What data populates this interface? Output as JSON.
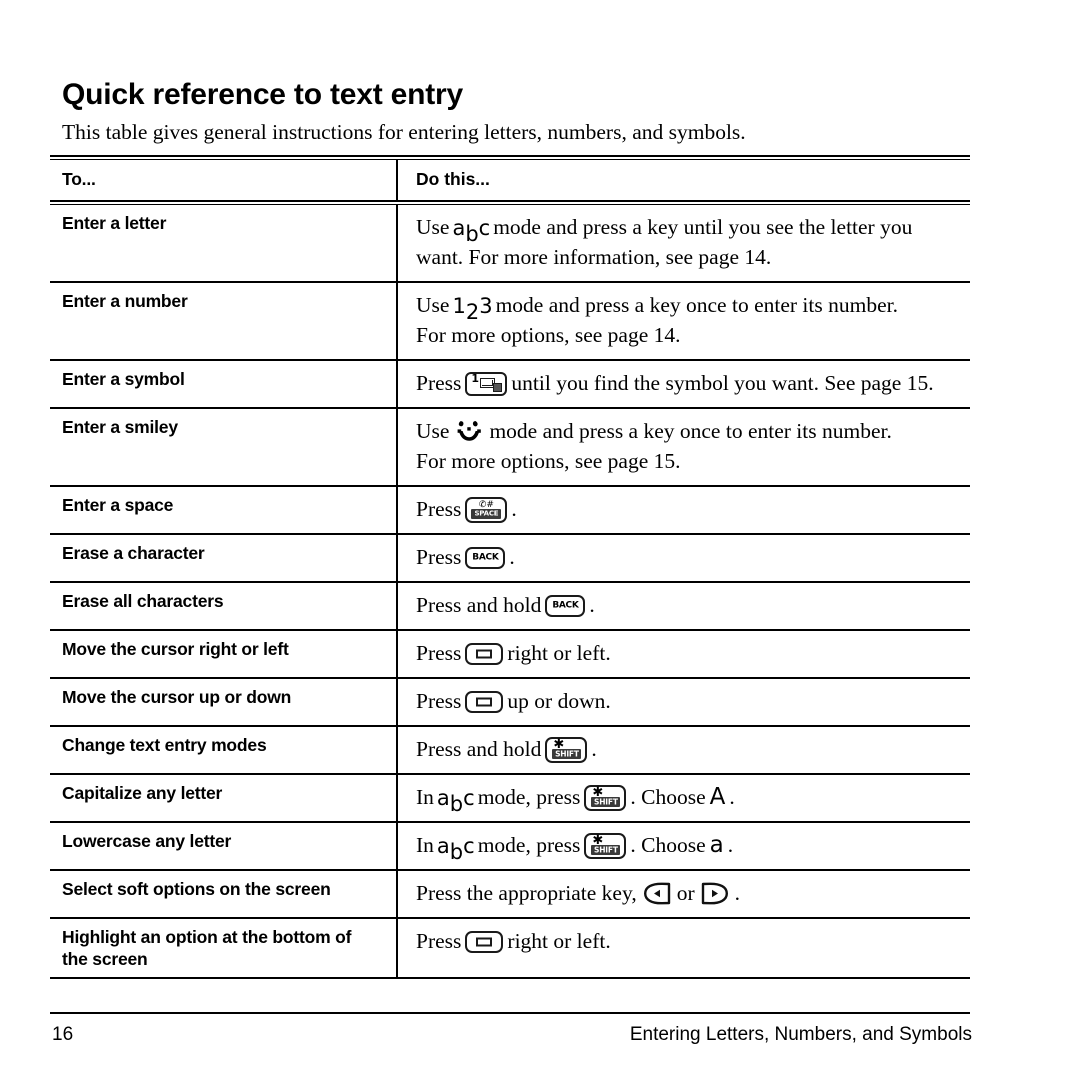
{
  "document": {
    "title": "Quick reference to text entry",
    "intro": "This table gives general instructions for entering letters, numbers, and symbols."
  },
  "table": {
    "headers": {
      "to": "To...",
      "do_this": "Do this..."
    },
    "rows": [
      {
        "label": "Enter a letter",
        "line1_pre": "Use",
        "icon": "abc-mode-icon",
        "icon_text": "abc",
        "line1_post": "mode and press a key until you see the letter you",
        "line2": "want. For more information, see page 14."
      },
      {
        "label": "Enter a number",
        "line1_pre": "Use",
        "icon": "123-mode-icon",
        "icon_text": "123",
        "line1_post": "mode and press a key once to enter its number.",
        "line2": "For more options, see page 14."
      },
      {
        "label": "Enter a symbol",
        "line1_pre": "Press",
        "icon": "one-symbol-key-icon",
        "icon_text": "1",
        "line1_post": "until you find the symbol you want. See page 15.",
        "line2": ""
      },
      {
        "label": "Enter a smiley",
        "line1_pre": "Use",
        "icon": "smiley-mode-icon",
        "icon_text": "smiley",
        "line1_post": "mode and press a key once to enter its number.",
        "line2": "For more options, see page 15."
      },
      {
        "label": "Enter a space",
        "line1_pre": "Press",
        "icon": "space-key-icon",
        "icon_text": "SPACE",
        "line1_post": ".",
        "line2": ""
      },
      {
        "label": "Erase a character",
        "line1_pre": "Press",
        "icon": "back-key-icon",
        "icon_text": "BACK",
        "line1_post": ".",
        "line2": ""
      },
      {
        "label": "Erase all characters",
        "line1_pre": "Press and hold",
        "icon": "back-key-icon",
        "icon_text": "BACK",
        "line1_post": ".",
        "line2": ""
      },
      {
        "label": "Move the cursor right or left",
        "line1_pre": "Press",
        "icon": "navigation-key-icon",
        "icon_text": "nav",
        "line1_post": "right or left.",
        "line2": ""
      },
      {
        "label": "Move the cursor up or down",
        "line1_pre": "Press",
        "icon": "navigation-key-icon",
        "icon_text": "nav",
        "line1_post": "up or down.",
        "line2": ""
      },
      {
        "label": "Change text entry modes",
        "line1_pre": "Press and hold",
        "icon": "shift-key-icon",
        "icon_text": "SHIFT",
        "line1_post": ".",
        "line2": ""
      },
      {
        "label": "Capitalize any letter",
        "line1_pre": "In",
        "icon": "abc-mode-icon",
        "icon_text": "abc",
        "line1_mid": "mode, press",
        "icon2": "shift-key-icon",
        "line1_post": ". Choose",
        "choice": "A",
        "line1_end": ".",
        "line2": ""
      },
      {
        "label": "Lowercase any letter",
        "line1_pre": "In",
        "icon": "abc-mode-icon",
        "icon_text": "abc",
        "line1_mid": "mode, press",
        "icon2": "shift-key-icon",
        "line1_post": ". Choose",
        "choice": "a",
        "line1_end": ".",
        "line2": ""
      },
      {
        "label": "Select soft options on the screen",
        "line1_pre": "Press the appropriate key,",
        "icon": "left-soft-key-icon",
        "conj": "or",
        "icon2": "right-soft-key-icon",
        "line1_post": ".",
        "line2": ""
      },
      {
        "label_line1": "Highlight an option at the bottom of",
        "label_line2": "the screen",
        "label": "Highlight an option at the bottom of the screen",
        "line1_pre": "Press",
        "icon": "navigation-key-icon",
        "icon_text": "nav",
        "line1_post": "right or left.",
        "line2": ""
      }
    ]
  },
  "footer": {
    "page_number": "16",
    "section": "Entering Letters, Numbers, and Symbols"
  },
  "colors": {
    "text": "#000000",
    "rule": "#000000",
    "key_outline": "#1a1a1a",
    "key_label_bar": "#3a3a3a",
    "background": "#ffffff"
  }
}
